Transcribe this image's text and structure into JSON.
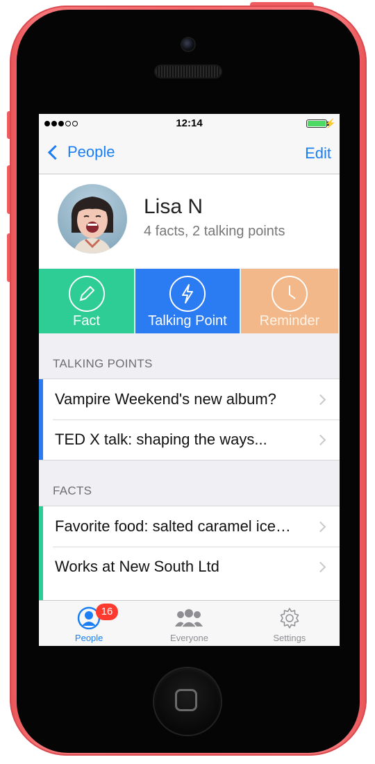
{
  "status_bar": {
    "time": "12:14",
    "signal_filled": 3,
    "signal_total": 5
  },
  "nav": {
    "back_label": "People",
    "edit_label": "Edit"
  },
  "profile": {
    "name": "Lisa N",
    "subtitle": "4 facts, 2 talking points"
  },
  "actions": [
    {
      "label": "Fact",
      "icon": "pencil-icon",
      "color": "#2ecd95"
    },
    {
      "label": "Talking Point",
      "icon": "lightning-icon",
      "color": "#2b7cf3"
    },
    {
      "label": "Reminder",
      "icon": "clock-icon",
      "color": "#f3b889"
    }
  ],
  "talking_points": {
    "header": "TALKING POINTS",
    "accent": "#2b7cf3",
    "items": [
      {
        "text": "Vampire Weekend's new album?"
      },
      {
        "text": "TED X talk: shaping the ways..."
      }
    ]
  },
  "facts": {
    "header": "FACTS",
    "accent": "#2ecd95",
    "items": [
      {
        "text": "Favorite food: salted caramel ice…"
      },
      {
        "text": "Works at New South Ltd"
      }
    ]
  },
  "tab_bar": {
    "tabs": [
      {
        "label": "People",
        "icon": "person-icon",
        "badge": "16",
        "active": true
      },
      {
        "label": "Everyone",
        "icon": "group-icon",
        "active": false
      },
      {
        "label": "Settings",
        "icon": "gear-icon",
        "active": false
      }
    ]
  },
  "colors": {
    "tint": "#1a7ef5",
    "phone_case": "#f6686c"
  }
}
